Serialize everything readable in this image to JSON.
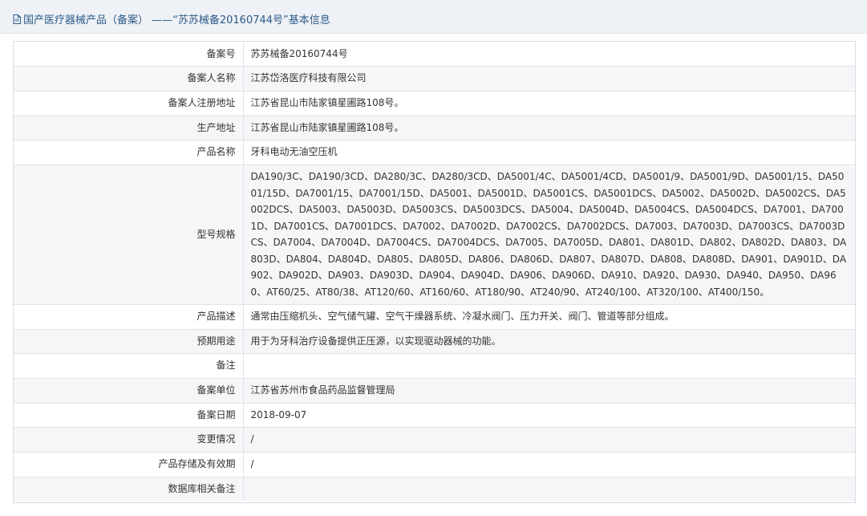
{
  "header": {
    "title": "国产医疗器械产品（备案） ——“苏苏械备20160744号”基本信息"
  },
  "rows": [
    {
      "label": "备案号",
      "value": "苏苏械备20160744号"
    },
    {
      "label": "备案人名称",
      "value": "江苏岱洛医疗科技有限公司"
    },
    {
      "label": "备案人注册地址",
      "value": "江苏省昆山市陆家镇星圃路108号。"
    },
    {
      "label": "生产地址",
      "value": "江苏省昆山市陆家镇星圃路108号。"
    },
    {
      "label": "产品名称",
      "value": "牙科电动无油空压机"
    },
    {
      "label": "型号规格",
      "value": "DA190/3C、DA190/3CD、DA280/3C、DA280/3CD、DA5001/4C、DA5001/4CD、DA5001/9、DA5001/9D、DA5001/15、DA5001/15D、DA7001/15、DA7001/15D、DA5001、DA5001D、DA5001CS、DA5001DCS、DA5002、DA5002D、DA5002CS、DA5002DCS、DA5003、DA5003D、DA5003CS、DA5003DCS、DA5004、DA5004D、DA5004CS、DA5004DCS、DA7001、DA7001D、DA7001CS、DA7001DCS、DA7002、DA7002D、DA7002CS、DA7002DCS、DA7003、DA7003D、DA7003CS、DA7003DCS、DA7004、DA7004D、DA7004CS、DA7004DCS、DA7005、DA7005D、DA801、DA801D、DA802、DA802D、DA803、DA803D、DA804、DA804D、DA805、DA805D、DA806、DA806D、DA807、DA807D、DA808、DA808D、DA901、DA901D、DA902、DA902D、DA903、DA903D、DA904、DA904D、DA906、DA906D、DA910、DA920、DA930、DA940、DA950、DA960、AT60/25、AT80/38、AT120/60、AT160/60、AT180/90、AT240/90、AT240/100、AT320/100、AT400/150。"
    },
    {
      "label": "产品描述",
      "value": "通常由压缩机头、空气储气罐、空气干燥器系统、冷凝水阀门、压力开关、阀门、管道等部分组成。"
    },
    {
      "label": "预期用途",
      "value": "用于为牙科治疗设备提供正压源，以实现驱动器械的功能。"
    },
    {
      "label": "备注",
      "value": ""
    },
    {
      "label": "备案单位",
      "value": "江苏省苏州市食品药品监督管理局"
    },
    {
      "label": "备案日期",
      "value": "2018-09-07"
    },
    {
      "label": "变更情况",
      "value": "/"
    },
    {
      "label": "产品存储及有效期",
      "value": "/"
    },
    {
      "label": "数据库相关备注",
      "value": ""
    }
  ]
}
